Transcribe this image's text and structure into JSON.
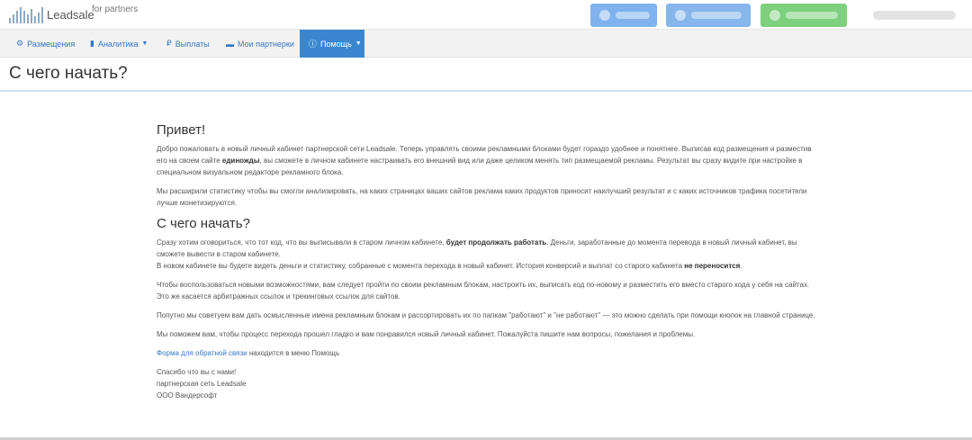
{
  "header": {
    "brand": "Leadsale",
    "brand_sub": "for partners"
  },
  "nav": {
    "items": [
      {
        "label": "Размещения",
        "icon": "gear-icon"
      },
      {
        "label": "Аналитика",
        "icon": "bar-chart-icon"
      },
      {
        "label": "Выплаты",
        "icon": "ruble-icon"
      },
      {
        "label": "Мои партнерки",
        "icon": "card-icon"
      },
      {
        "label": "Помощь",
        "icon": "info-icon"
      }
    ]
  },
  "page": {
    "title": "С чего начать?"
  },
  "article": {
    "heading1": "Привет!",
    "p1_a": "Добро пожаловать в новый личный кабинет партнерской сети Leadsale. Теперь управлять своими рекламными блоками будет гораздо удобнее и понятнее. Выписав код размещения и разместив его на своем сайте ",
    "p1_b": "единожды",
    "p1_c": ", вы сможете в личном кабинете настраивать его внешний вид или даже целиком менять тип размещаемой рекламы. Результат вы сразу видите при настройке в специальном визуальном редакторе рекламного блока.",
    "p2": "Мы расширили статистику чтобы вы смогли анализировать, на каких страницах ваших сайтов реклама каких продуктов приносит наилучший результат и с каких источников трафика посетители лучше монетизируются.",
    "heading2": "С чего начать?",
    "p3_a": "Сразу хотим оговориться, что тот код, что вы выписывали в старом личном кабинете, ",
    "p3_b": "будет продолжать работать",
    "p3_c": ". Деньги, заработанные до момента перевода в новый личный кабинет, вы сможете вывести в старом кабинете.",
    "p3_d": "В новом кабинете вы будете видеть деньги и статистику, собранные с момента перехода в новый кабинет. История конверсий и выплат со старого кабинета ",
    "p3_e": "не переносится",
    "p3_f": ".",
    "p4": "Чтобы воспользоваться новыми возможностями, вам следует пройти по своим рекламным блокам, настроить их, выписать код по-новому и разместить его вместо старого кода у себя на сайтах. Это же касается арбитражных ссылок и трекинговых ссылок для сайтов.",
    "p5": "Попутно мы советуем вам дать осмысленные имена рекламным блокам и рассортировать их по папкам \"работают\" и \"не работают\" — это можно сделать при помощи кнопок на главной странице.",
    "p6": "Мы поможем вам, чтобы процесс перехода прошел гладко и вам понравился новый личный кабинет. Пожалуйста пишите нам вопросы, пожелания и проблемы.",
    "feedback_link": "Форма для обратной связи",
    "feedback_rest": " находится в меню Помощь",
    "sig1": "Спасибо что вы с нами!",
    "sig2": "партнерская сеть Leadsale",
    "sig3": "ООО Вандерсофт"
  }
}
